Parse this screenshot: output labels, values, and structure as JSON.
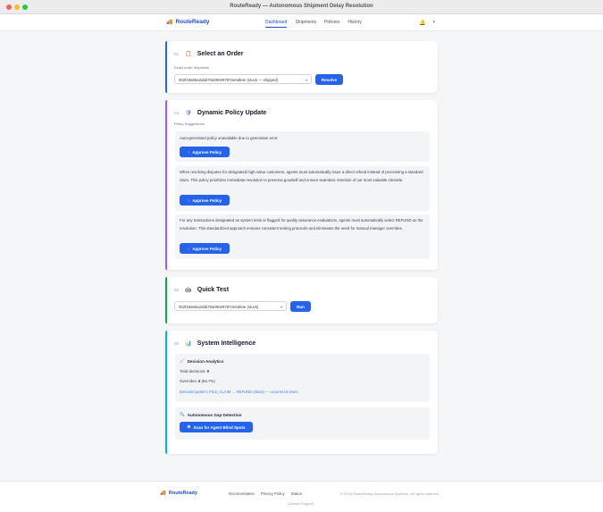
{
  "window": {
    "title": "RouteReady — Autonomous Shipment Delay Resolution"
  },
  "header": {
    "logo": "RouteReady",
    "nav": [
      "Dashboard",
      "Shipments",
      "Policies",
      "History"
    ]
  },
  "icons": {
    "logo": "truck-icon",
    "notifications": "bell-icon",
    "theme": "moon-icon"
  },
  "colors": {
    "brand": "#1d4ed8",
    "button": "#2563eb",
    "accent_order": "#2563eb",
    "accent_policy": "#a855f7",
    "accent_test": "#16a34a",
    "accent_intel": "#06b6d4"
  },
  "select_order": {
    "step": "01.",
    "title": "Select an Order",
    "label": "Exact order dropdown",
    "value": "002f19a65a2ddd70a090297872e6d64e (stuck — shipped)",
    "button": "Resolve"
  },
  "policy_update": {
    "step": "04.",
    "title": "Dynamic Policy Update",
    "label": "Policy Suggestions",
    "suggestions": [
      {
        "text": "Auto-generated policy unavailable due to generation error.",
        "button": "Approve Policy"
      },
      {
        "text": "When resolving disputes for designated high-value customers, agents must automatically issue a direct refund instead of processing a standard claim. This policy prioritizes immediate resolution to preserve goodwill and ensure seamless retention of our most valuable clientele.",
        "button": "Approve Policy"
      },
      {
        "text": "For any transactions designated as system tests or flagged for quality assurance evaluations, agents must automatically select REFUND as the resolution. This standardized approach ensures consistent testing protocols and eliminates the need for manual manager overrides.",
        "button": "Approve Policy"
      }
    ]
  },
  "quick_test": {
    "step": "05.",
    "title": "Quick Test",
    "value": "002f19a65a2ddd70a090297872e6d64e (stuck)",
    "button": "Run"
  },
  "intelligence": {
    "step": "06.",
    "title": "System Intelligence",
    "analytics_title": "Decision Analytics",
    "total_label": "Total decisions:",
    "total_value": "9",
    "overrides_label": "Overrides:",
    "overrides_value": "6",
    "overrides_pct": "(66.7%)",
    "pattern": "Detected pattern: FILE_CLAIM → REFUND (stuck) — occurred 5 times",
    "gap_title": "Autonomous Gap Detection",
    "scan_button": "Scan for Agent Blind Spots"
  },
  "footer": {
    "logo": "RouteReady",
    "links": [
      "Documentation",
      "Privacy Policy",
      "Status"
    ],
    "copyright": "© 2024 RouteReady Autonomous Systems. All rights reserved.",
    "contact": "Contact Support"
  }
}
